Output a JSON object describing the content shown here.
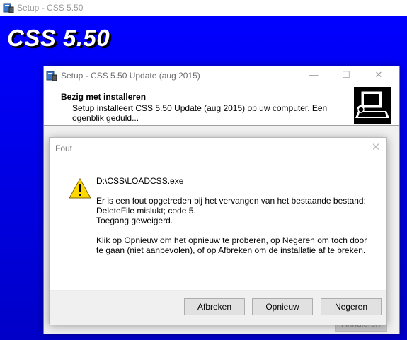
{
  "outer_window": {
    "title": "Setup - CSS 5.50"
  },
  "backdrop": {
    "title": "CSS 5.50"
  },
  "installer": {
    "title": "Setup - CSS 5.50 Update (aug 2015)",
    "caption_min": "—",
    "caption_max": "☐",
    "caption_close": "✕",
    "header_title": "Bezig met installeren",
    "header_desc": "Setup installeert CSS 5.50 Update (aug 2015) op uw computer. Een ogenblik geduld...",
    "cancel_label": "Annuleren"
  },
  "error_dialog": {
    "title": "Fout",
    "close_glyph": "✕",
    "icon": "warning-icon",
    "file_path": "D:\\CSS\\LOADCSS.exe",
    "error_line1": "Er is een fout opgetreden bij het vervangen van het bestaande bestand:",
    "error_line2": "DeleteFile mislukt; code 5.",
    "error_line3": "Toegang geweigerd.",
    "instructions": "Klik op Opnieuw om het opnieuw te proberen, op Negeren om toch door te gaan (niet aanbevolen), of op Afbreken om de installatie af te breken.",
    "buttons": {
      "abort": "Afbreken",
      "retry": "Opnieuw",
      "ignore": "Negeren"
    }
  },
  "colors": {
    "backdrop_blue": "#0000ff",
    "warning_yellow": "#ffd800"
  }
}
